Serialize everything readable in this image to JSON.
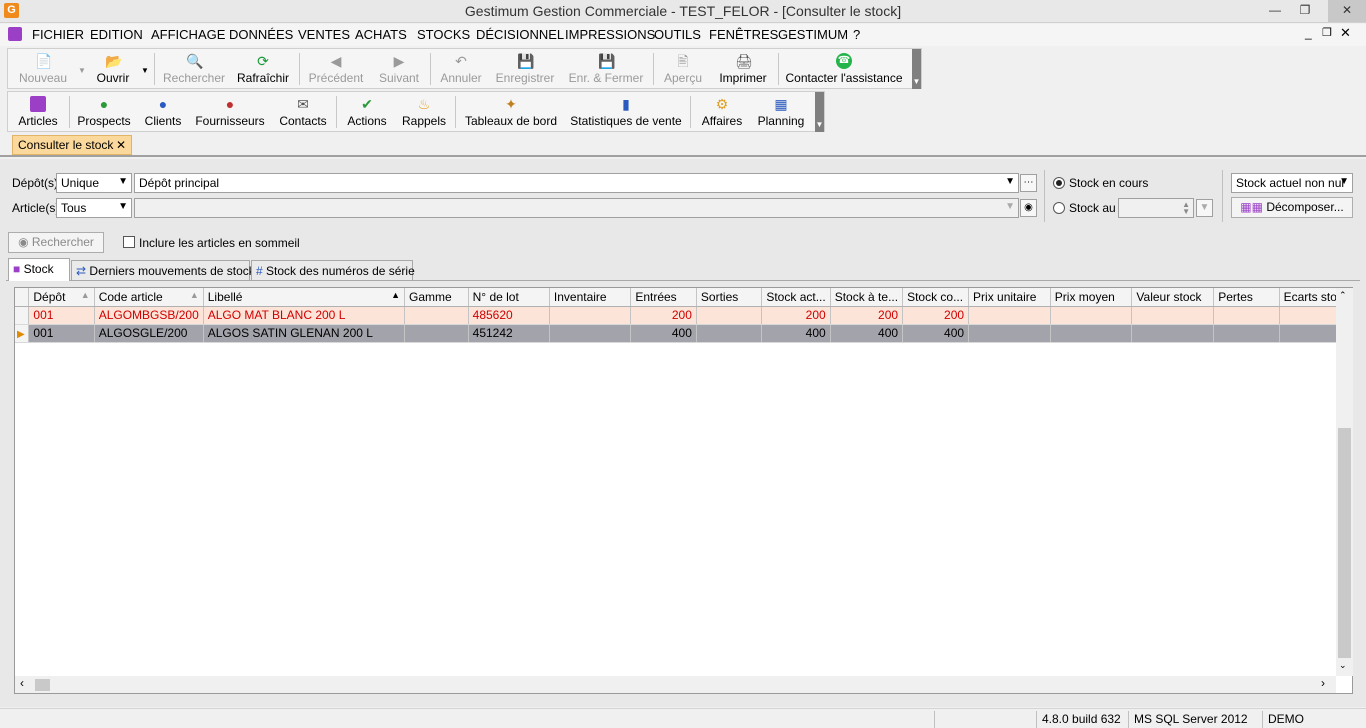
{
  "window": {
    "title": "Gestimum Gestion Commerciale - TEST_FELOR - [Consulter le stock]",
    "app_icon": "G"
  },
  "menu": [
    "FICHIER",
    "EDITION",
    "AFFICHAGE",
    "DONNÉES",
    "VENTES",
    "ACHATS",
    "STOCKS",
    "DÉCISIONNEL",
    "IMPRESSIONS",
    "OUTILS",
    "FENÊTRES",
    "GESTIMUM",
    "?"
  ],
  "toolbar1": {
    "nouveau": "Nouveau",
    "ouvrir": "Ouvrir",
    "rechercher": "Rechercher",
    "rafraichir": "Rafraîchir",
    "precedent": "Précédent",
    "suivant": "Suivant",
    "annuler": "Annuler",
    "enregistrer": "Enregistrer",
    "enr_fermer": "Enr. & Fermer",
    "apercu": "Aperçu",
    "imprimer": "Imprimer",
    "assistance": "Contacter l'assistance"
  },
  "toolbar2": {
    "articles": "Articles",
    "prospects": "Prospects",
    "clients": "Clients",
    "fournisseurs": "Fournisseurs",
    "contacts": "Contacts",
    "actions": "Actions",
    "rappels": "Rappels",
    "tableaux": "Tableaux de bord",
    "statistiques": "Statistiques de vente",
    "affaires": "Affaires",
    "planning": "Planning"
  },
  "doc_tab": "Consulter le stock",
  "filters": {
    "depot_label": "Dépôt(s)",
    "depot_mode": "Unique",
    "depot_value": "Dépôt principal",
    "article_label": "Article(s)",
    "article_mode": "Tous",
    "article_value": "",
    "radio_en_cours": "Stock en cours",
    "radio_au": "Stock au",
    "stock_filter": "Stock actuel non nul",
    "decomposer": "Décomposer...",
    "rechercher": "Rechercher",
    "inclure_sommeil": "Inclure les articles en sommeil"
  },
  "tabs": [
    "Stock",
    "Derniers mouvements de stock",
    "Stock des numéros de série"
  ],
  "grid": {
    "columns": [
      "Dépôt",
      "Code article",
      "Libellé",
      "Gamme",
      "N° de lot",
      "Inventaire",
      "Entrées",
      "Sorties",
      "Stock act...",
      "Stock à te...",
      "Stock co...",
      "Prix unitaire",
      "Prix moyen",
      "Valeur stock",
      "Pertes",
      "Ecarts sto..."
    ],
    "rows": [
      [
        "001",
        "ALGOMBGSB/200",
        "ALGO MAT BLANC 200 L",
        "",
        "485620",
        "",
        "200",
        "",
        "200",
        "200",
        "200",
        "",
        "",
        "",
        "",
        ""
      ],
      [
        "001",
        "ALGOSGLE/200",
        "ALGOS SATIN GLENAN 200 L",
        "",
        "451242",
        "",
        "400",
        "",
        "400",
        "400",
        "400",
        "",
        "",
        "",
        "",
        ""
      ]
    ]
  },
  "status": {
    "version": "4.8.0 build 632",
    "db": "MS SQL Server 2012",
    "mode": "DEMO"
  }
}
